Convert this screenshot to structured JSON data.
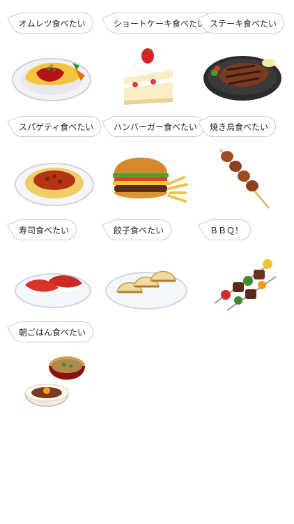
{
  "stickers": [
    {
      "label": "オムレツ食べたい",
      "icon": "omelette-rice"
    },
    {
      "label": "ショートケーキ食べたい",
      "icon": "strawberry-shortcake"
    },
    {
      "label": "ステーキ食べたい",
      "icon": "steak"
    },
    {
      "label": "スパゲティ食べたい",
      "icon": "spaghetti"
    },
    {
      "label": "ハンバーガー食べたい",
      "icon": "hamburger"
    },
    {
      "label": "焼き鳥食べたい",
      "icon": "yakitori"
    },
    {
      "label": "寿司食べたい",
      "icon": "sushi"
    },
    {
      "label": "餃子食べたい",
      "icon": "gyoza"
    },
    {
      "label": "ＢＢＱ！",
      "icon": "bbq-skewers"
    },
    {
      "label": "朝ごはん食べたい",
      "icon": "breakfast-set"
    }
  ]
}
